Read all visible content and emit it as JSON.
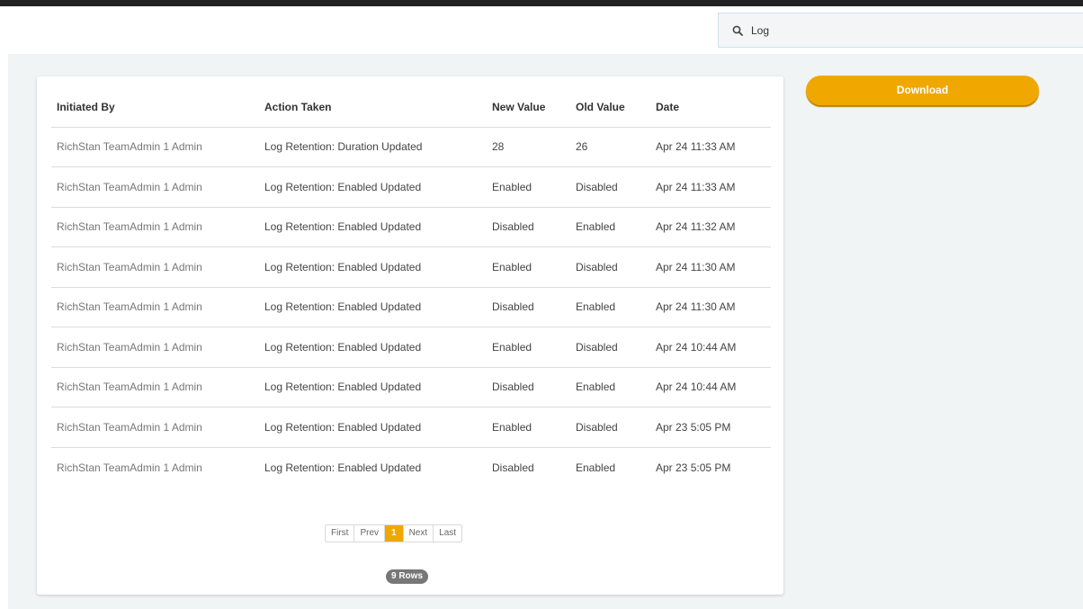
{
  "search": {
    "value": "Log"
  },
  "table": {
    "headers": {
      "initiated_by": "Initiated By",
      "action_taken": "Action Taken",
      "new_value": "New Value",
      "old_value": "Old Value",
      "date": "Date"
    },
    "rows": [
      {
        "initiated_by": "RichStan TeamAdmin 1 Admin",
        "action_taken": "Log Retention: Duration Updated",
        "new_value": "28",
        "old_value": "26",
        "date": "Apr 24 11:33 AM"
      },
      {
        "initiated_by": "RichStan TeamAdmin 1 Admin",
        "action_taken": "Log Retention: Enabled Updated",
        "new_value": "Enabled",
        "old_value": "Disabled",
        "date": "Apr 24 11:33 AM"
      },
      {
        "initiated_by": "RichStan TeamAdmin 1 Admin",
        "action_taken": "Log Retention: Enabled Updated",
        "new_value": "Disabled",
        "old_value": "Enabled",
        "date": "Apr 24 11:32 AM"
      },
      {
        "initiated_by": "RichStan TeamAdmin 1 Admin",
        "action_taken": "Log Retention: Enabled Updated",
        "new_value": "Enabled",
        "old_value": "Disabled",
        "date": "Apr 24 11:30 AM"
      },
      {
        "initiated_by": "RichStan TeamAdmin 1 Admin",
        "action_taken": "Log Retention: Enabled Updated",
        "new_value": "Disabled",
        "old_value": "Enabled",
        "date": "Apr 24 11:30 AM"
      },
      {
        "initiated_by": "RichStan TeamAdmin 1 Admin",
        "action_taken": "Log Retention: Enabled Updated",
        "new_value": "Enabled",
        "old_value": "Disabled",
        "date": "Apr 24 10:44 AM"
      },
      {
        "initiated_by": "RichStan TeamAdmin 1 Admin",
        "action_taken": "Log Retention: Enabled Updated",
        "new_value": "Disabled",
        "old_value": "Enabled",
        "date": "Apr 24 10:44 AM"
      },
      {
        "initiated_by": "RichStan TeamAdmin 1 Admin",
        "action_taken": "Log Retention: Enabled Updated",
        "new_value": "Enabled",
        "old_value": "Disabled",
        "date": "Apr 23 5:05 PM"
      },
      {
        "initiated_by": "RichStan TeamAdmin 1 Admin",
        "action_taken": "Log Retention: Enabled Updated",
        "new_value": "Disabled",
        "old_value": "Enabled",
        "date": "Apr 23 5:05 PM"
      }
    ]
  },
  "pagination": {
    "first": "First",
    "prev": "Prev",
    "current": "1",
    "next": "Next",
    "last": "Last"
  },
  "rows_count": "9 Rows",
  "download": {
    "label": "Download"
  },
  "colors": {
    "accent": "#f0a800",
    "background": "#f1f4f5",
    "top_border": "#222222"
  },
  "icons": {
    "search": "search-icon"
  }
}
